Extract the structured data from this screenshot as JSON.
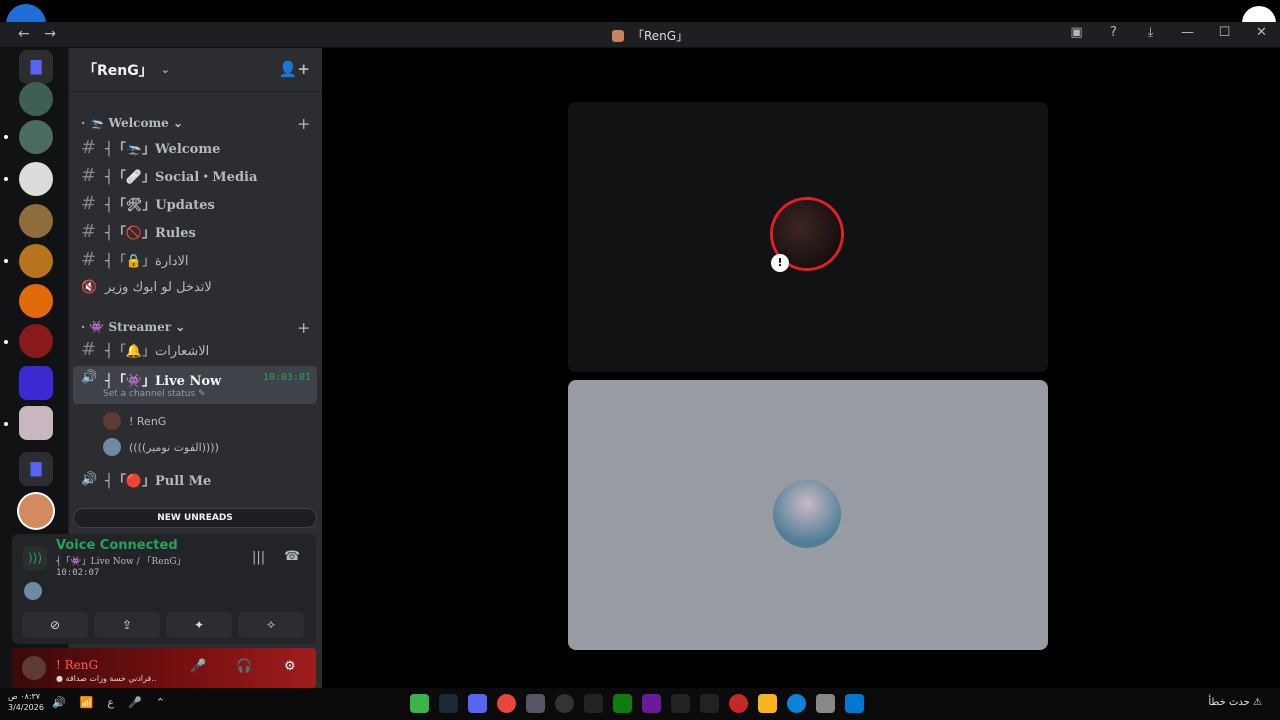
{
  "window": {
    "title": "「RenG」",
    "back_glyph": "←",
    "forward_glyph": "→",
    "tools": [
      "▣",
      "?",
      "⤓",
      "—",
      "☐",
      "✕"
    ]
  },
  "guild": {
    "name": "「RenG」",
    "chevron": "⌄",
    "invite_icon": "👤+"
  },
  "categories": [
    {
      "label": "· 🛬 Welcome ⌄",
      "plus": "+"
    },
    {
      "label": "· 👾 Streamer ⌄",
      "plus": "+"
    }
  ],
  "channels": [
    {
      "icon": "#",
      "name": "┤「🛬」Welcome"
    },
    {
      "icon": "#",
      "name": "┤「🩹」Social・Media"
    },
    {
      "icon": "#",
      "name": "┤「🛠」Updates"
    },
    {
      "icon": "#",
      "name": "┤「🚫」Rules"
    },
    {
      "icon": "#",
      "name": "┤「🔒」الادارة"
    },
    {
      "icon": "🔇",
      "name": "لاتدخل لو ابوك وزير"
    },
    {
      "icon": "#",
      "name": "┤「🔔」الاشعارات"
    },
    {
      "icon": "🔊",
      "name": "┤「👾」Live Now",
      "time": "10:03:01",
      "status": "Set a channel status ✎"
    },
    {
      "icon": "🔊",
      "name": "┤「🔴」Pull Me"
    }
  ],
  "voice_users": [
    {
      "name": "! RenG"
    },
    {
      "name": "((((الفوت نومير))))"
    }
  ],
  "new_unreads": "NEW UNREADS",
  "voice": {
    "connected": "Voice Connected",
    "location": "┤「👾」Live Now / 「RenG」",
    "elapsed": "10:02:07",
    "buttons": [
      "⊘",
      "⇪",
      "✦",
      "✧"
    ]
  },
  "user": {
    "name": "! RenG",
    "status": "● فرادني خسة وزات صداقة.."
  },
  "taskbar": {
    "time": "٠٨:٣٧ ص",
    "date": "3/4/2026",
    "tray": [
      "🔊",
      "📶",
      "ع",
      "🎤",
      "⌃"
    ],
    "notify": "حدث خطأ ⚠"
  },
  "colors": {
    "accent_green": "#23a559",
    "blurple": "#5865f2",
    "speaking_red": "#e21f26"
  }
}
